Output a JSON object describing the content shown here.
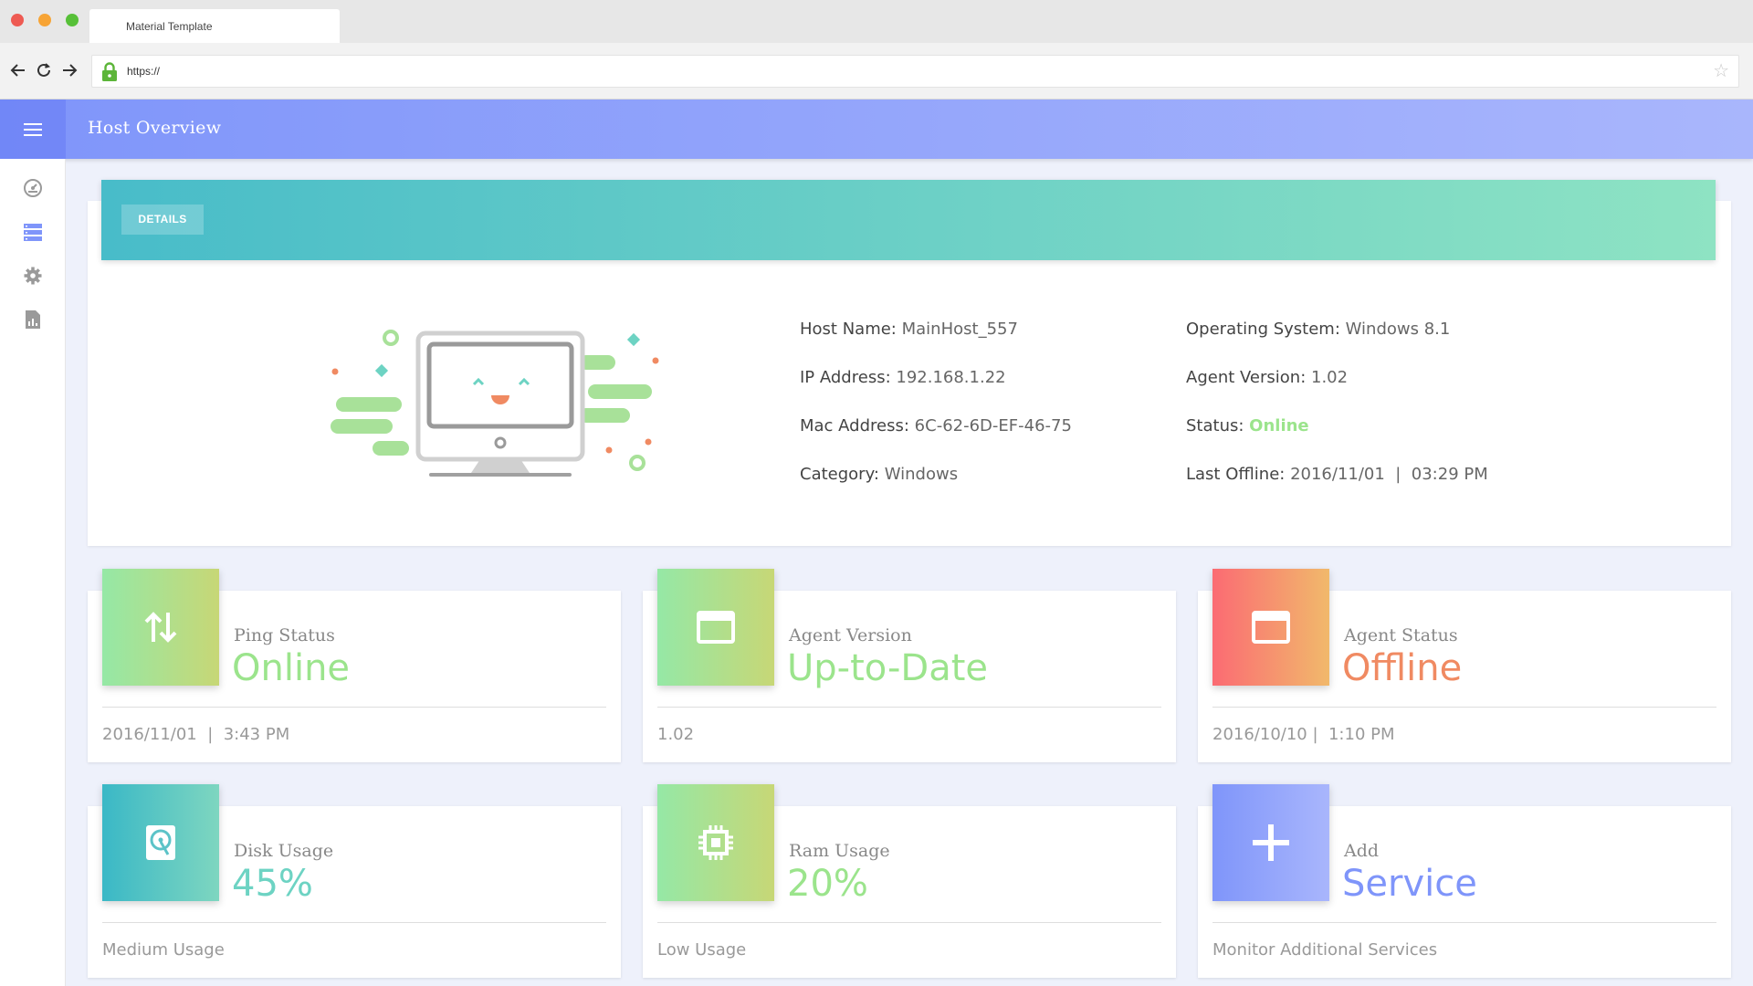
{
  "browser": {
    "tab_title": "Material Template",
    "url": "https://",
    "colors": {
      "close": "#ee5a52",
      "minimize": "#f7a435",
      "maximize": "#57c038"
    }
  },
  "app": {
    "title": "Host Overview",
    "sidebar": [
      "dashboard-icon",
      "servers-icon",
      "settings-icon",
      "report-icon"
    ]
  },
  "details": {
    "chip": "DETAILS",
    "host_name": {
      "label": "Host Name:",
      "value": "MainHost_557"
    },
    "ip": {
      "label": "IP Address:",
      "value": "192.168.1.22"
    },
    "mac": {
      "label": "Mac Address:",
      "value": "6C-62-6D-EF-46-75"
    },
    "category": {
      "label": "Category:",
      "value": "Windows"
    },
    "os": {
      "label": "Operating System:",
      "value": "Windows 8.1"
    },
    "agent_version": {
      "label": "Agent Version:",
      "value": "1.02"
    },
    "status": {
      "label": "Status:",
      "value": "Online"
    },
    "last_offline": {
      "label": "Last Offline:",
      "value": "2016/11/01  |  03:29 PM"
    }
  },
  "cards": {
    "ping": {
      "label": "Ping Status",
      "value": "Online",
      "footer": "2016/11/01  |  3:43 PM",
      "color": "#9be48c"
    },
    "agent_version": {
      "label": "Agent Version",
      "value": "Up-to-Date",
      "footer": "1.02",
      "color": "#9be48c"
    },
    "agent_status": {
      "label": "Agent Status",
      "value": "Offline",
      "footer": "2016/10/10 |  1:10 PM",
      "color": "#f08a62"
    },
    "disk": {
      "label": "Disk Usage",
      "value": "45%",
      "footer": "Medium Usage",
      "color": "#6dd3c3"
    },
    "ram": {
      "label": "Ram Usage",
      "value": "20%",
      "footer": "Low Usage",
      "color": "#9be48c"
    },
    "service": {
      "label": "Add",
      "value": "Service",
      "footer": "Monitor Additional Services",
      "color": "#7f95fa"
    }
  }
}
